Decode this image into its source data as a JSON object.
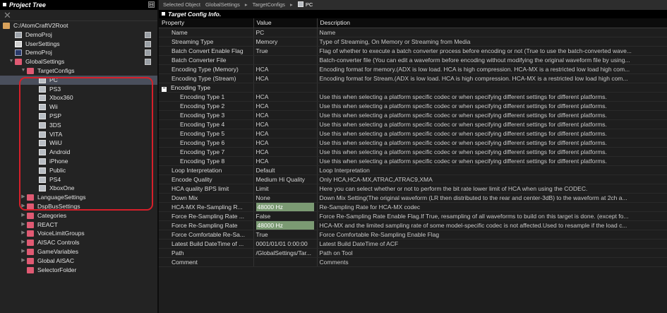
{
  "project_tree": {
    "title": "Project Tree",
    "collapse_glyph": "⊟",
    "close_glyph": "✕",
    "items": [
      {
        "label": "C:/AtomCraftV2Root",
        "indent": 0,
        "icon": "folder-root",
        "expander": "",
        "save": false,
        "selected": false
      },
      {
        "label": "DemoProj",
        "indent": 1,
        "icon": "file",
        "expander": "",
        "save": true,
        "selected": false
      },
      {
        "label": "UserSettings",
        "indent": 1,
        "icon": "gear",
        "expander": "",
        "save": true,
        "selected": false
      },
      {
        "label": "DemoProj",
        "indent": 1,
        "icon": "doc",
        "expander": "",
        "save": true,
        "selected": false
      },
      {
        "label": "GlobalSettings",
        "indent": 1,
        "icon": "folder",
        "expander": "▼",
        "save": true,
        "selected": false
      },
      {
        "label": "TargetConfigs",
        "indent": 2,
        "icon": "folder",
        "expander": "▼",
        "save": false,
        "selected": false
      },
      {
        "label": "PC",
        "indent": 3,
        "icon": "platform",
        "expander": "",
        "save": false,
        "selected": true
      },
      {
        "label": "PS3",
        "indent": 3,
        "icon": "platform",
        "expander": "",
        "save": false,
        "selected": false
      },
      {
        "label": "Xbox360",
        "indent": 3,
        "icon": "platform",
        "expander": "",
        "save": false,
        "selected": false
      },
      {
        "label": "Wii",
        "indent": 3,
        "icon": "platform",
        "expander": "",
        "save": false,
        "selected": false
      },
      {
        "label": "PSP",
        "indent": 3,
        "icon": "platform",
        "expander": "",
        "save": false,
        "selected": false
      },
      {
        "label": "3DS",
        "indent": 3,
        "icon": "platform",
        "expander": "",
        "save": false,
        "selected": false
      },
      {
        "label": "VITA",
        "indent": 3,
        "icon": "platform",
        "expander": "",
        "save": false,
        "selected": false
      },
      {
        "label": "WiiU",
        "indent": 3,
        "icon": "platform",
        "expander": "",
        "save": false,
        "selected": false
      },
      {
        "label": "Android",
        "indent": 3,
        "icon": "platform",
        "expander": "",
        "save": false,
        "selected": false
      },
      {
        "label": "iPhone",
        "indent": 3,
        "icon": "platform",
        "expander": "",
        "save": false,
        "selected": false
      },
      {
        "label": "Public",
        "indent": 3,
        "icon": "platform",
        "expander": "",
        "save": false,
        "selected": false
      },
      {
        "label": "PS4",
        "indent": 3,
        "icon": "platform",
        "expander": "",
        "save": false,
        "selected": false
      },
      {
        "label": "XboxOne",
        "indent": 3,
        "icon": "platform",
        "expander": "",
        "save": false,
        "selected": false
      },
      {
        "label": "LanguageSettings",
        "indent": 2,
        "icon": "folder",
        "expander": "▶",
        "save": false,
        "selected": false
      },
      {
        "label": "DspBusSettings",
        "indent": 2,
        "icon": "folder",
        "expander": "▶",
        "save": false,
        "selected": false
      },
      {
        "label": "Categories",
        "indent": 2,
        "icon": "folder",
        "expander": "▶",
        "save": false,
        "selected": false
      },
      {
        "label": "REACT",
        "indent": 2,
        "icon": "folder",
        "expander": "▶",
        "save": false,
        "selected": false
      },
      {
        "label": "VoiceLimitGroups",
        "indent": 2,
        "icon": "folder",
        "expander": "▶",
        "save": false,
        "selected": false
      },
      {
        "label": "AISAC Controls",
        "indent": 2,
        "icon": "folder",
        "expander": "▶",
        "save": false,
        "selected": false
      },
      {
        "label": "GameVariables",
        "indent": 2,
        "icon": "folder",
        "expander": "▶",
        "save": false,
        "selected": false
      },
      {
        "label": "Global AISAC",
        "indent": 2,
        "icon": "folder",
        "expander": "▶",
        "save": false,
        "selected": false
      },
      {
        "label": "SelectorFolder",
        "indent": 2,
        "icon": "folder",
        "expander": "",
        "save": false,
        "selected": false
      }
    ]
  },
  "breadcrumb": {
    "label": "Selected Object",
    "segments": [
      "GlobalSettings",
      "TargetConfigs"
    ],
    "separator": "▸",
    "current": "PC"
  },
  "section": {
    "title": "Target Config Info."
  },
  "grid": {
    "columns": [
      "Property",
      "Value",
      "Description"
    ],
    "rows": [
      {
        "property": "Name",
        "value": "PC",
        "description": "Name",
        "level": "prop"
      },
      {
        "property": "Streaming Type",
        "value": "Memory",
        "description": "Type of Streaming, On Memory or Streaming from Media",
        "level": "prop"
      },
      {
        "property": "Batch Convert Enable Flag",
        "value": "True",
        "description": "Flag of whether to execute a batch converter process before encoding or not (True to use the batch-converted wave...",
        "level": "prop"
      },
      {
        "property": "Batch Converter File",
        "value": "",
        "description": "Batch-converter file (You can edit a waveform before encoding without modifying the original waveform file by using...",
        "level": "prop"
      },
      {
        "property": "Encoding Type (Memory)",
        "value": "HCA",
        "description": "Encoding format for memory.(ADX is low load. HCA is high compression. HCA-MX is a restricted low load high com...",
        "level": "prop"
      },
      {
        "property": "Encoding Type (Stream)",
        "value": "HCA",
        "description": "Encoding format for Stream.(ADX is low load. HCA is high compression. HCA-MX is a restricted low load high com...",
        "level": "prop"
      },
      {
        "property": "Encoding Type",
        "value": "",
        "description": "",
        "level": "group"
      },
      {
        "property": "Encoding Type 1",
        "value": "HCA",
        "description": "Use this when selecting a platform specific codec or when specifying different settings for different platforms.",
        "level": "sub"
      },
      {
        "property": "Encoding Type 2",
        "value": "HCA",
        "description": "Use this when selecting a platform specific codec or when specifying different settings for different platforms.",
        "level": "sub"
      },
      {
        "property": "Encoding Type 3",
        "value": "HCA",
        "description": "Use this when selecting a platform specific codec or when specifying different settings for different platforms.",
        "level": "sub"
      },
      {
        "property": "Encoding Type 4",
        "value": "HCA",
        "description": "Use this when selecting a platform specific codec or when specifying different settings for different platforms.",
        "level": "sub"
      },
      {
        "property": "Encoding Type 5",
        "value": "HCA",
        "description": "Use this when selecting a platform specific codec or when specifying different settings for different platforms.",
        "level": "sub"
      },
      {
        "property": "Encoding Type 6",
        "value": "HCA",
        "description": "Use this when selecting a platform specific codec or when specifying different settings for different platforms.",
        "level": "sub"
      },
      {
        "property": "Encoding Type 7",
        "value": "HCA",
        "description": "Use this when selecting a platform specific codec or when specifying different settings for different platforms.",
        "level": "sub"
      },
      {
        "property": "Encoding Type 8",
        "value": "HCA",
        "description": "Use this when selecting a platform specific codec or when specifying different settings for different platforms.",
        "level": "sub"
      },
      {
        "property": "Loop Interpretation",
        "value": "Default",
        "description": "Loop Interpretation",
        "level": "prop"
      },
      {
        "property": "Encode Quality",
        "value": "Medium Hi Quality",
        "description": "Only HCA,HCA-MX,ATRAC,ATRAC9,XMA",
        "level": "prop"
      },
      {
        "property": "HCA quality BPS limit",
        "value": "Limit",
        "description": "Here you can select whether or not to perform the bit rate lower limit of HCA when using the CODEC.",
        "level": "prop"
      },
      {
        "property": "Down Mix",
        "value": "None",
        "description": "Down Mix Setting(The original waveform (LR then distributed to the rear and center-3dB) to the waveform at 2ch a...",
        "level": "prop"
      },
      {
        "property": "HCA-MX Re-Sampling R...",
        "value": "48000 Hz",
        "description": "Re-Sampling Rate for HCA-MX codec",
        "level": "prop",
        "highlight": true
      },
      {
        "property": "Force Re-Sampling Rate ...",
        "value": "False",
        "description": "Force Re-Sampling Rate Enable Flag.If True, resampling of all waveforms to build on this target is done. (except fo...",
        "level": "prop"
      },
      {
        "property": "Force Re-Sampling Rate",
        "value": "48000 Hz",
        "description": "HCA-MX and the limited sampling rate of some model-specific codec is not affected.Used to resample if the load c...",
        "level": "prop",
        "highlight": true
      },
      {
        "property": "Force Comfortable Re-Sa...",
        "value": "True",
        "description": "Force Comfortable Re-Sampling Enable Flag",
        "level": "prop"
      },
      {
        "property": "Latest Build DateTime of ...",
        "value": "0001/01/01 0:00:00",
        "description": "Latest Build DateTime of ACF",
        "level": "prop"
      },
      {
        "property": "Path",
        "value": "/GlobalSettings/Tar...",
        "description": "Path on Tool",
        "level": "prop"
      },
      {
        "property": "Comment",
        "value": "",
        "description": "Comments",
        "level": "prop"
      }
    ]
  },
  "colors": {
    "highlight_box": "#d61f2a",
    "folder": "#e05a73",
    "selected_row": "#4a4f5c",
    "value_highlight": "#7b9a73"
  }
}
